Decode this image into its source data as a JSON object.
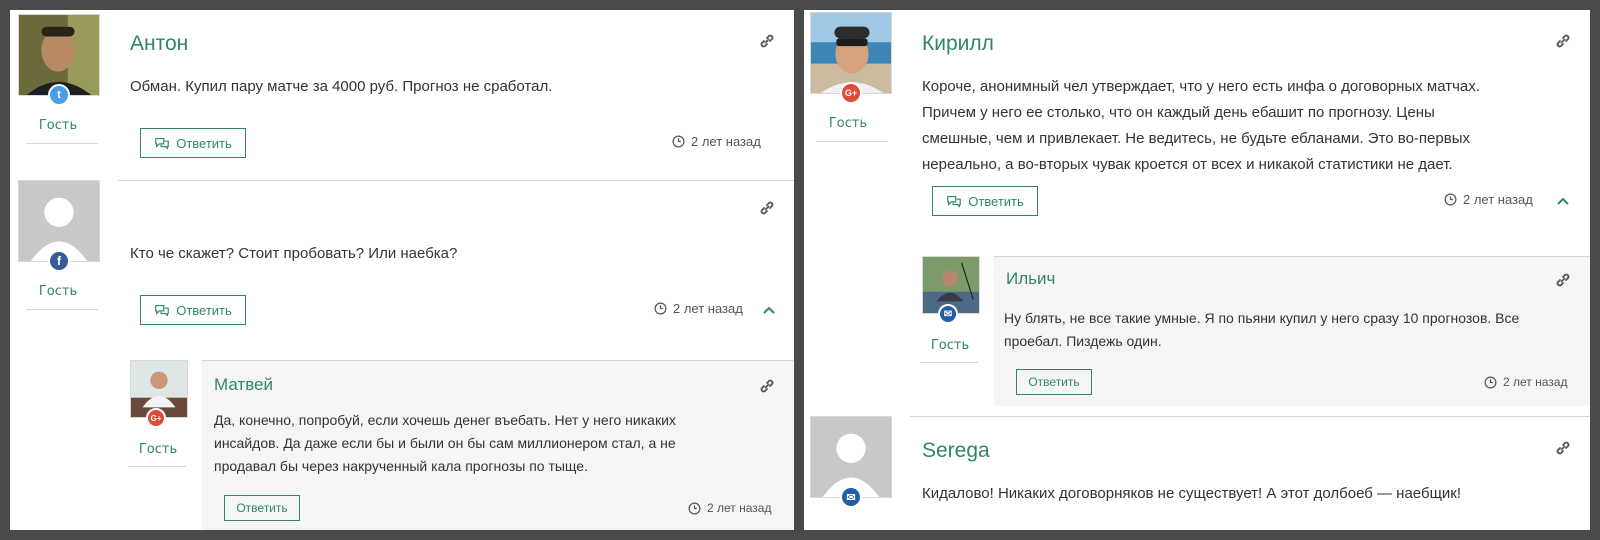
{
  "colors": {
    "accent": "#2f8766",
    "twitter": "#4a9ee5",
    "google": "#dd4b39",
    "facebook": "#3b5998",
    "email": "#1f5fa8"
  },
  "left": {
    "c1": {
      "author": "Антон",
      "text": "Обман. Купил пару матче за 4000 руб. Прогноз не сработал.",
      "guest": "Гость",
      "reply": "Ответить",
      "time": "2 лет назад",
      "badge": "twitter-icon"
    },
    "c2": {
      "author": "",
      "text": "Кто че скажет? Стоит пробовать? Или наебка?",
      "guest": "Гость",
      "reply": "Ответить",
      "time": "2 лет назад",
      "badge": "facebook-icon"
    },
    "c3": {
      "author": "Матвей",
      "lines": [
        "Да, конечно, попробуй, если хочешь денег въебать. Нет у него никаких",
        "инсайдов. Да даже если бы и были он бы сам миллионером стал, а не",
        "продавал бы через накрученный кала прогнозы по тыще."
      ],
      "guest": "Гость",
      "reply": "Ответить",
      "time": "2 лет назад",
      "badge": "google-plus-icon"
    }
  },
  "right": {
    "c1": {
      "author": "Кирилл",
      "lines": [
        "Короче, анонимный чел утверждает, что у него есть инфа о договорных матчах.",
        "Причем у него ее столько, что он каждый день ебашит по прогнозу. Цены",
        "смешные, чем и привлекает. Не ведитесь, не будьте ебланами. Это во-первых",
        "нереально, а во-вторых чувак кроется от всех и никакой статистики не дает."
      ],
      "guest": "Гость",
      "reply": "Ответить",
      "time": "2 лет назад",
      "badge": "google-plus-icon"
    },
    "c2": {
      "author": "Ильич",
      "lines": [
        "Ну блять, не все такие умные. Я по пьяни купил у него сразу 10 прогнозов. Все",
        "проебал. Пиздежь один."
      ],
      "guest": "Гость",
      "reply": "Ответить",
      "time": "2 лет назад",
      "badge": "email-icon"
    },
    "c3": {
      "author": "Serega",
      "text": "Кидалово! Никаких договорняков не существует! А этот долбоеб — наебщик!",
      "badge": "email-icon"
    }
  }
}
